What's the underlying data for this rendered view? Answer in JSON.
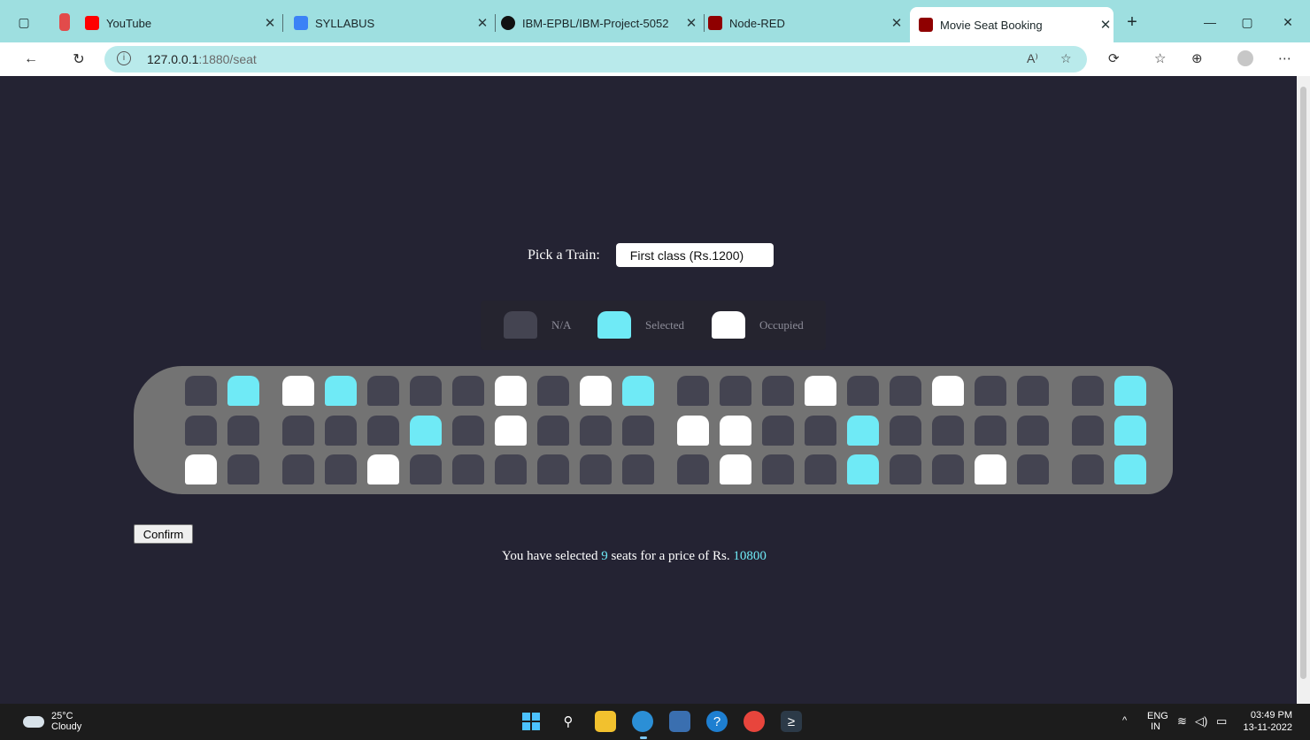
{
  "browser": {
    "tabs": [
      {
        "title": "YouTube",
        "favicon_color": "#ff0000"
      },
      {
        "title": "SYLLABUS",
        "favicon_color": "#3b82f6"
      },
      {
        "title": "IBM-EPBL/IBM-Project-5052",
        "favicon_color": "#111111"
      },
      {
        "title": "Node-RED",
        "favicon_color": "#8f0000"
      },
      {
        "title": "Movie Seat Booking",
        "favicon_color": "#8f0000",
        "active": true
      }
    ],
    "url_host": "127.0.0.1",
    "url_path": ":1880/seat",
    "new_tab_glyph": "+"
  },
  "page": {
    "picker_label": "Pick a Train:",
    "picker_value": "First class (Rs.1200)",
    "legend": [
      {
        "label": "N/A",
        "status": "na"
      },
      {
        "label": "Selected",
        "status": "sel"
      },
      {
        "label": "Occupied",
        "status": "occ"
      }
    ],
    "seat_rows": [
      [
        "na",
        "sel",
        "occ",
        "sel",
        "na",
        "na",
        "na",
        "occ",
        "na",
        "occ",
        "sel",
        "na",
        "na",
        "na",
        "occ",
        "na",
        "na",
        "occ",
        "na",
        "na",
        "na",
        "sel"
      ],
      [
        "na",
        "na",
        "na",
        "na",
        "na",
        "sel",
        "na",
        "occ",
        "na",
        "na",
        "na",
        "occ",
        "occ",
        "na",
        "na",
        "sel",
        "na",
        "na",
        "na",
        "na",
        "na",
        "sel"
      ],
      [
        "occ",
        "na",
        "na",
        "na",
        "occ",
        "na",
        "na",
        "na",
        "na",
        "na",
        "na",
        "na",
        "occ",
        "na",
        "na",
        "sel",
        "na",
        "na",
        "occ",
        "na",
        "na",
        "sel"
      ]
    ],
    "confirm_label": "Confirm",
    "summary_prefix": "You have selected",
    "selected_count": "9",
    "summary_middle": "seats for a price of Rs.",
    "total_price": "10800",
    "colors": {
      "background": "#242333",
      "selected": "#6feaf6",
      "occupied": "#ffffff",
      "na": "#444451",
      "train": "#737373"
    }
  },
  "taskbar": {
    "temperature": "25°C",
    "weather": "Cloudy",
    "lang_top": "ENG",
    "lang_bottom": "IN",
    "time": "03:49 PM",
    "date": "13-11-2022"
  }
}
